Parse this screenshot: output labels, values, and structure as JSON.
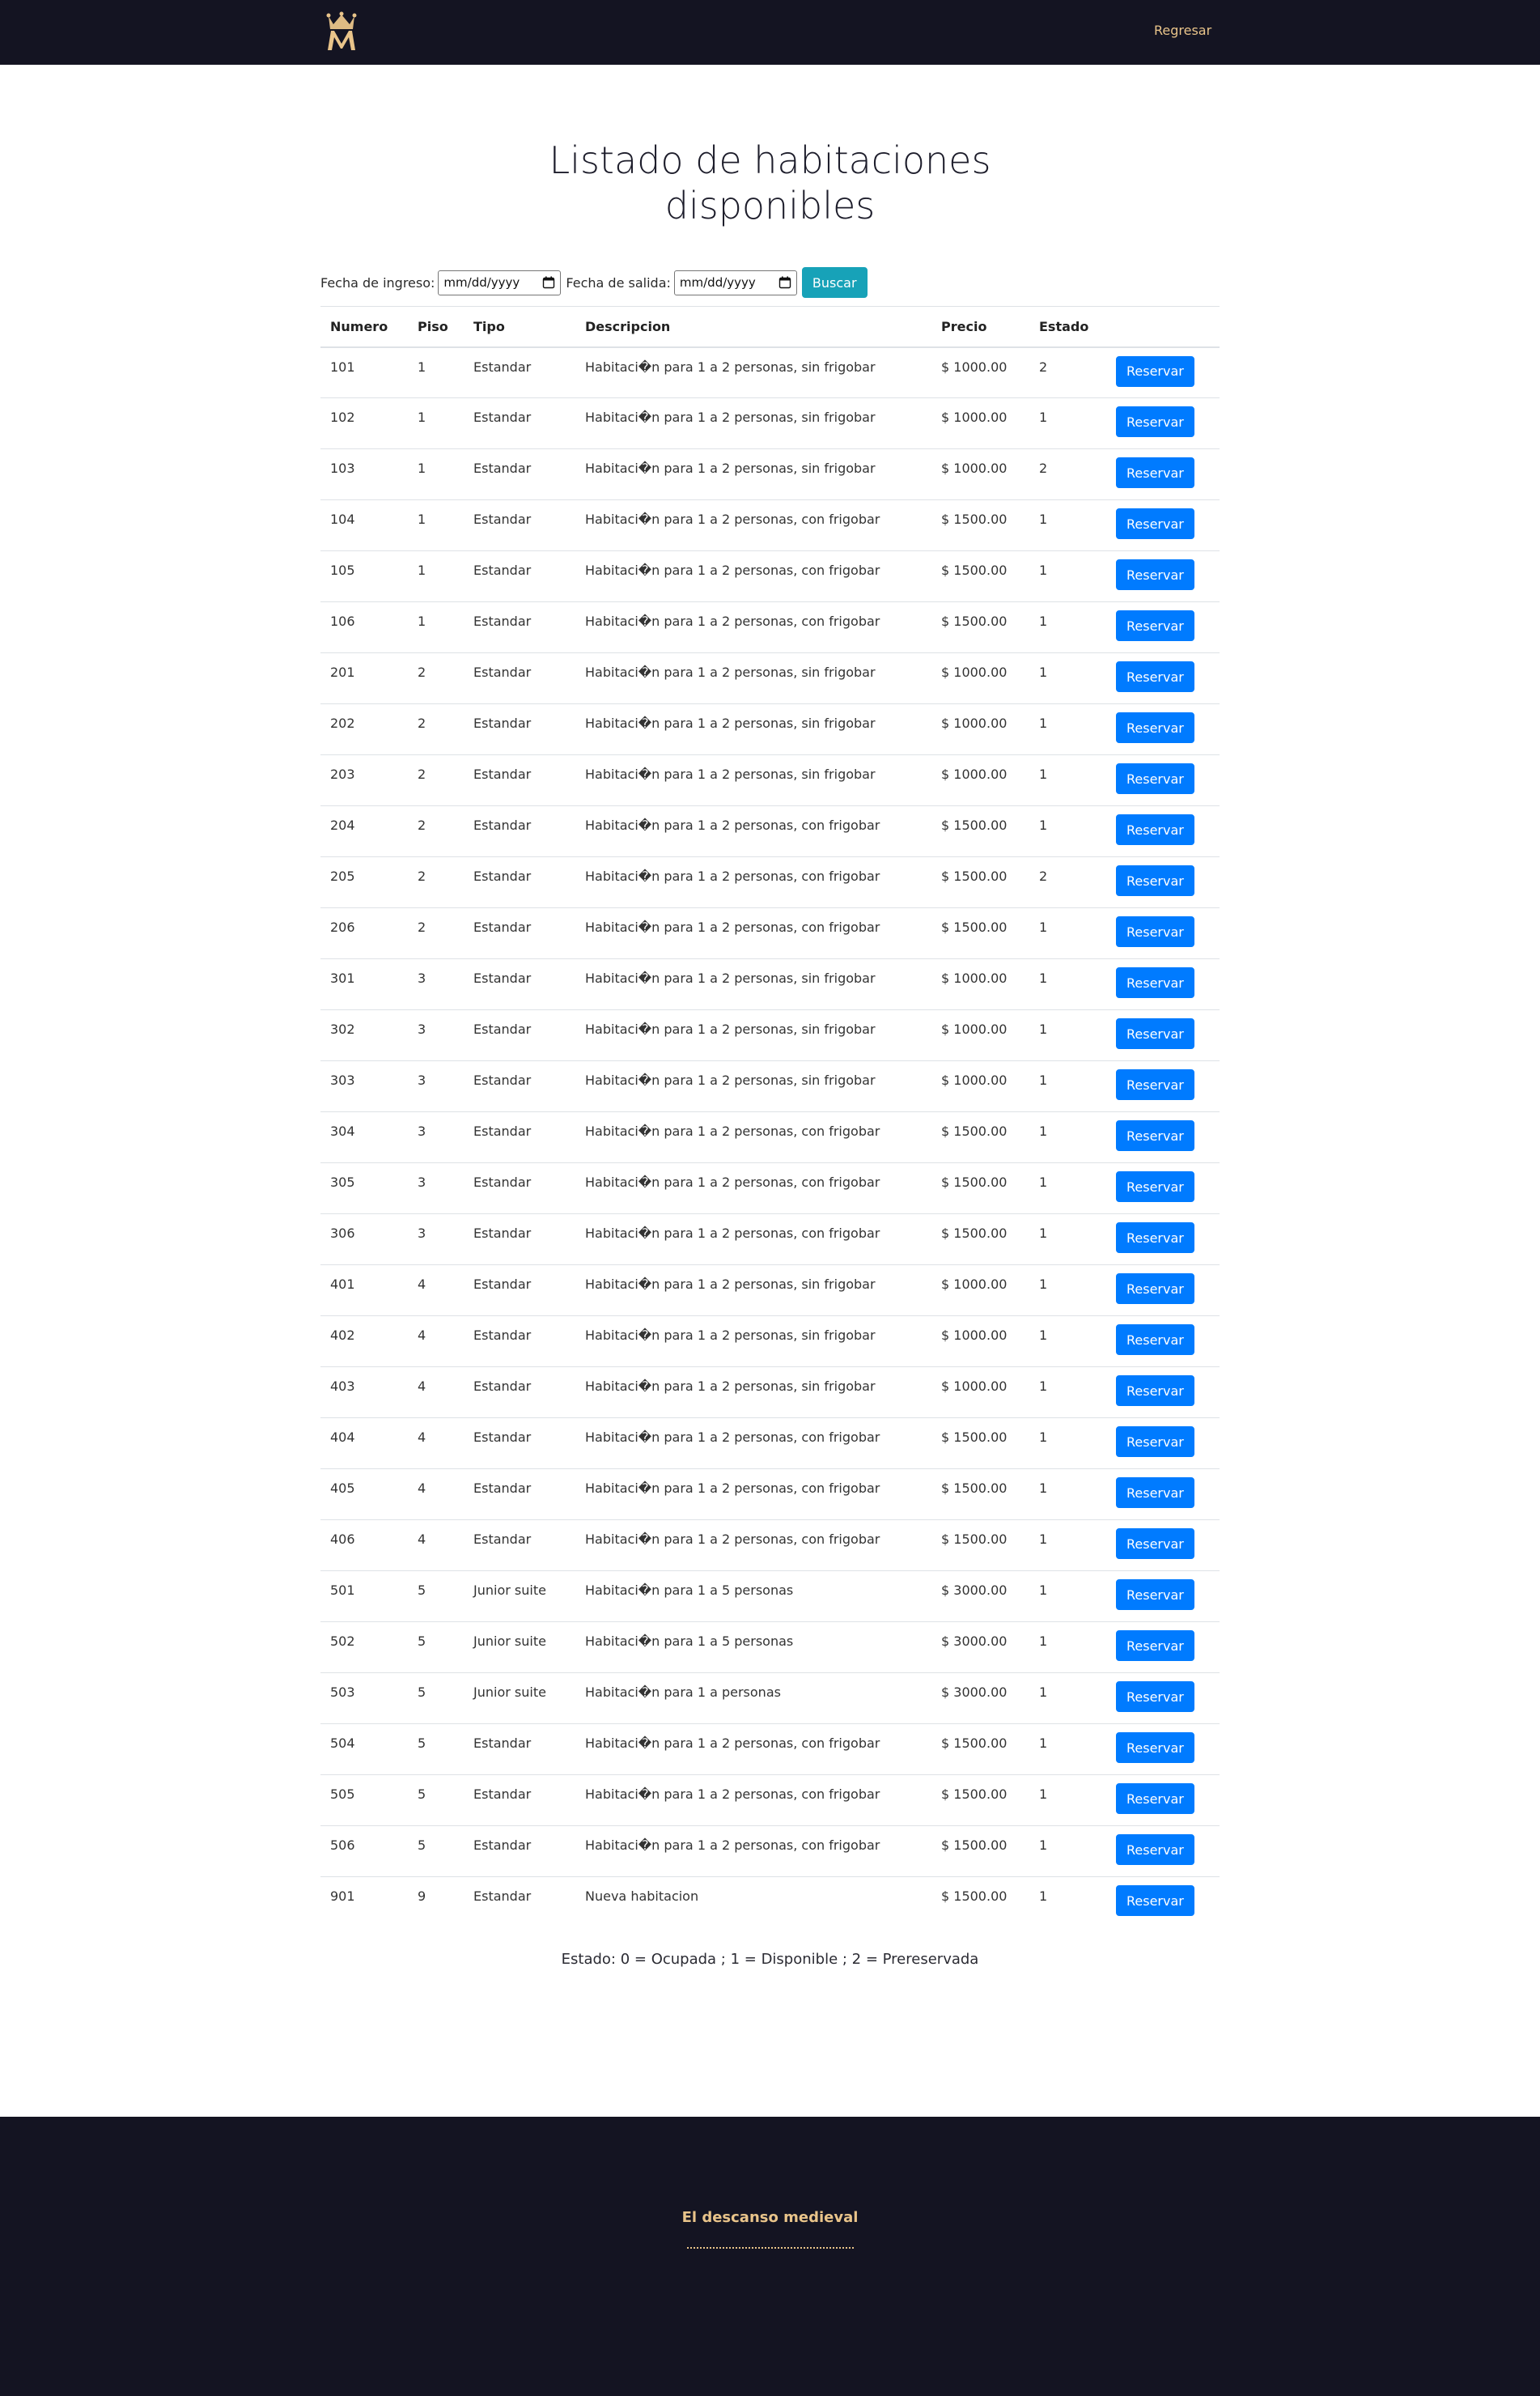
{
  "nav": {
    "back_label": "Regresar"
  },
  "page": {
    "title": "Listado de habitaciones disponibles"
  },
  "search": {
    "checkin_label": "Fecha de ingreso:",
    "checkin_placeholder": "mm/dd/yyyy",
    "checkout_label": "Fecha de salida:",
    "checkout_placeholder": "mm/dd/yyyy",
    "button_label": "Buscar"
  },
  "table": {
    "headers": [
      "Numero",
      "Piso",
      "Tipo",
      "Descripcion",
      "Precio",
      "Estado"
    ],
    "action_label": "Reservar",
    "rows": [
      [
        "101",
        "1",
        "Estandar",
        "Habitaci�n para 1 a 2 personas, sin frigobar",
        "$ 1000.00",
        "2"
      ],
      [
        "102",
        "1",
        "Estandar",
        "Habitaci�n para 1 a 2 personas, sin frigobar",
        "$ 1000.00",
        "1"
      ],
      [
        "103",
        "1",
        "Estandar",
        "Habitaci�n para 1 a 2 personas, sin frigobar",
        "$ 1000.00",
        "2"
      ],
      [
        "104",
        "1",
        "Estandar",
        "Habitaci�n para 1 a 2 personas, con frigobar",
        "$ 1500.00",
        "1"
      ],
      [
        "105",
        "1",
        "Estandar",
        "Habitaci�n para 1 a 2 personas, con frigobar",
        "$ 1500.00",
        "1"
      ],
      [
        "106",
        "1",
        "Estandar",
        "Habitaci�n para 1 a 2 personas, con frigobar",
        "$ 1500.00",
        "1"
      ],
      [
        "201",
        "2",
        "Estandar",
        "Habitaci�n para 1 a 2 personas, sin frigobar",
        "$ 1000.00",
        "1"
      ],
      [
        "202",
        "2",
        "Estandar",
        "Habitaci�n para 1 a 2 personas, sin frigobar",
        "$ 1000.00",
        "1"
      ],
      [
        "203",
        "2",
        "Estandar",
        "Habitaci�n para 1 a 2 personas, sin frigobar",
        "$ 1000.00",
        "1"
      ],
      [
        "204",
        "2",
        "Estandar",
        "Habitaci�n para 1 a 2 personas, con frigobar",
        "$ 1500.00",
        "1"
      ],
      [
        "205",
        "2",
        "Estandar",
        "Habitaci�n para 1 a 2 personas, con frigobar",
        "$ 1500.00",
        "2"
      ],
      [
        "206",
        "2",
        "Estandar",
        "Habitaci�n para 1 a 2 personas, con frigobar",
        "$ 1500.00",
        "1"
      ],
      [
        "301",
        "3",
        "Estandar",
        "Habitaci�n para 1 a 2 personas, sin frigobar",
        "$ 1000.00",
        "1"
      ],
      [
        "302",
        "3",
        "Estandar",
        "Habitaci�n para 1 a 2 personas, sin frigobar",
        "$ 1000.00",
        "1"
      ],
      [
        "303",
        "3",
        "Estandar",
        "Habitaci�n para 1 a 2 personas, sin frigobar",
        "$ 1000.00",
        "1"
      ],
      [
        "304",
        "3",
        "Estandar",
        "Habitaci�n para 1 a 2 personas, con frigobar",
        "$ 1500.00",
        "1"
      ],
      [
        "305",
        "3",
        "Estandar",
        "Habitaci�n para 1 a 2 personas, con frigobar",
        "$ 1500.00",
        "1"
      ],
      [
        "306",
        "3",
        "Estandar",
        "Habitaci�n para 1 a 2 personas, con frigobar",
        "$ 1500.00",
        "1"
      ],
      [
        "401",
        "4",
        "Estandar",
        "Habitaci�n para 1 a 2 personas, sin frigobar",
        "$ 1000.00",
        "1"
      ],
      [
        "402",
        "4",
        "Estandar",
        "Habitaci�n para 1 a 2 personas, sin frigobar",
        "$ 1000.00",
        "1"
      ],
      [
        "403",
        "4",
        "Estandar",
        "Habitaci�n para 1 a 2 personas, sin frigobar",
        "$ 1000.00",
        "1"
      ],
      [
        "404",
        "4",
        "Estandar",
        "Habitaci�n para 1 a 2 personas, con frigobar",
        "$ 1500.00",
        "1"
      ],
      [
        "405",
        "4",
        "Estandar",
        "Habitaci�n para 1 a 2 personas, con frigobar",
        "$ 1500.00",
        "1"
      ],
      [
        "406",
        "4",
        "Estandar",
        "Habitaci�n para 1 a 2 personas, con frigobar",
        "$ 1500.00",
        "1"
      ],
      [
        "501",
        "5",
        "Junior suite",
        "Habitaci�n para 1 a 5 personas",
        "$ 3000.00",
        "1"
      ],
      [
        "502",
        "5",
        "Junior suite",
        "Habitaci�n para 1 a 5 personas",
        "$ 3000.00",
        "1"
      ],
      [
        "503",
        "5",
        "Junior suite",
        "Habitaci�n para 1 a personas",
        "$ 3000.00",
        "1"
      ],
      [
        "504",
        "5",
        "Estandar",
        "Habitaci�n para 1 a 2 personas, con frigobar",
        "$ 1500.00",
        "1"
      ],
      [
        "505",
        "5",
        "Estandar",
        "Habitaci�n para 1 a 2 personas, con frigobar",
        "$ 1500.00",
        "1"
      ],
      [
        "506",
        "5",
        "Estandar",
        "Habitaci�n para 1 a 2 personas, con frigobar",
        "$ 1500.00",
        "1"
      ],
      [
        "901",
        "9",
        "Estandar",
        "Nueva habitacion",
        "$ 1500.00",
        "1"
      ]
    ]
  },
  "legend": "Estado: 0 = Ocupada ; 1 = Disponible ; 2 = Prereservada",
  "footer": {
    "title": "El descanso medieval"
  },
  "icons": {
    "logo": "crown-m-logo",
    "calendar": "calendar-icon"
  },
  "colors": {
    "navbar": "#141422",
    "accent": "#e9c48a",
    "primary": "#007bff",
    "info": "#17a2b8"
  }
}
